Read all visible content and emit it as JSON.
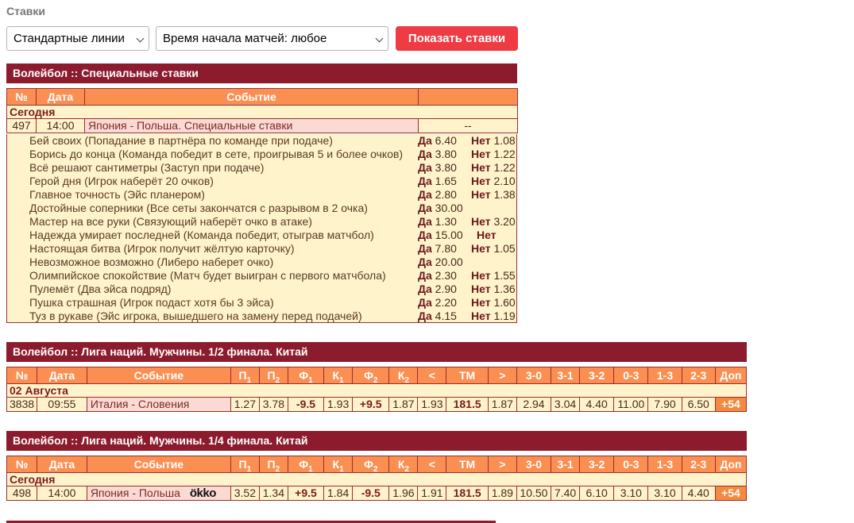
{
  "page": {
    "title": "Ставки"
  },
  "controls": {
    "lines_select": "Стандартные линии",
    "time_select": "Время начала матчей: любое",
    "show_button": "Показать ставки"
  },
  "special": {
    "heading": "Волейбол :: Специальные ставки",
    "columns": [
      "№",
      "Дата",
      "Событие",
      ""
    ],
    "group": "Сегодня",
    "event": {
      "num": "497",
      "time": "14:00",
      "name": "Япония - Польша. Специальные ставки",
      "odds": "--"
    },
    "yes_label": "Да",
    "no_label": "Нет",
    "markets": [
      {
        "name": "Бей своих (Попадание в партнёра по команде при подаче)",
        "yes": "6.40",
        "no": "1.08"
      },
      {
        "name": "Борись до конца (Команда победит в сете, проигрывая 5 и более очков)",
        "yes": "3.80",
        "no": "1.22"
      },
      {
        "name": "Всё решают сантиметры (Заступ при подаче)",
        "yes": "3.80",
        "no": "1.22"
      },
      {
        "name": "Герой дня (Игрок наберёт 20 очков)",
        "yes": "1.65",
        "no": "2.10"
      },
      {
        "name": "Главное точность (Эйс планером)",
        "yes": "2.80",
        "no": "1.38"
      },
      {
        "name": "Достойные соперники (Все сеты закончатся с разрывом в 2 очка)",
        "yes": "30.00",
        "no": ""
      },
      {
        "name": "Мастер на все руки (Связующий наберёт очко в атаке)",
        "yes": "1.30",
        "no": "3.20"
      },
      {
        "name": "Надежда умирает последней (Команда победит, отыграв матчбол)",
        "yes": "15.00",
        "no": "",
        "no_label_only": true
      },
      {
        "name": "Настоящая битва (Игрок получит жёлтую карточку)",
        "yes": "7.80",
        "no": "1.05"
      },
      {
        "name": "Невозможное возможно (Либеро наберет очко)",
        "yes": "20.00",
        "no": ""
      },
      {
        "name": "Олимпийское спокойствие (Матч будет выигран с первого матчбола)",
        "yes": "2.30",
        "no": "1.55"
      },
      {
        "name": "Пулемёт (Два эйса подряд)",
        "yes": "2.90",
        "no": "1.36"
      },
      {
        "name": "Пушка страшная (Игрок подаст хотя бы 3 эйса)",
        "yes": "2.20",
        "no": "1.60"
      },
      {
        "name": "Туз в рукаве (Эйс игрока, вышедшего на замену перед подачей)",
        "yes": "4.15",
        "no": "1.19"
      }
    ]
  },
  "odds_columns": {
    "num": "№",
    "date": "Дата",
    "event": "Событие",
    "p": "П",
    "k": "К",
    "f": "Ф",
    "lt": "<",
    "tm": "ТМ",
    "gt": ">",
    "s30": "3-0",
    "s31": "3-1",
    "s32": "3-2",
    "s03": "0-3",
    "s13": "1-3",
    "s23": "2-3",
    "dop": "Доп"
  },
  "semifinal": {
    "heading": "Волейбол :: Лига наций. Мужчины. 1/2 финала. Китай",
    "group": "02 Августа",
    "row": {
      "num": "3838",
      "time": "09:55",
      "name": "Италия - Словения",
      "p1": "1.27",
      "p2": "3.78",
      "f1": "-9.5",
      "k1": "1.93",
      "f2": "+9.5",
      "k2": "1.87",
      "lt": "1.93",
      "tm": "181.5",
      "gt": "1.87",
      "s30": "2.94",
      "s31": "3.04",
      "s32": "4.40",
      "s03": "11.00",
      "s13": "7.90",
      "s23": "6.50",
      "dop": "+54"
    }
  },
  "quarterfinal": {
    "heading": "Волейбол :: Лига наций. Мужчины. 1/4 финала. Китай",
    "group": "Сегодня",
    "row": {
      "num": "498",
      "time": "14:00",
      "name": "Япония - Польша",
      "broadcaster": "ökko",
      "p1": "3.52",
      "p2": "1.34",
      "f1": "+9.5",
      "k1": "1.84",
      "f2": "-9.5",
      "k2": "1.96",
      "lt": "1.91",
      "tm": "181.5",
      "gt": "1.89",
      "s30": "10.50",
      "s31": "7.40",
      "s32": "6.10",
      "s03": "3.10",
      "s13": "3.10",
      "s23": "4.40",
      "dop": "+54"
    }
  }
}
